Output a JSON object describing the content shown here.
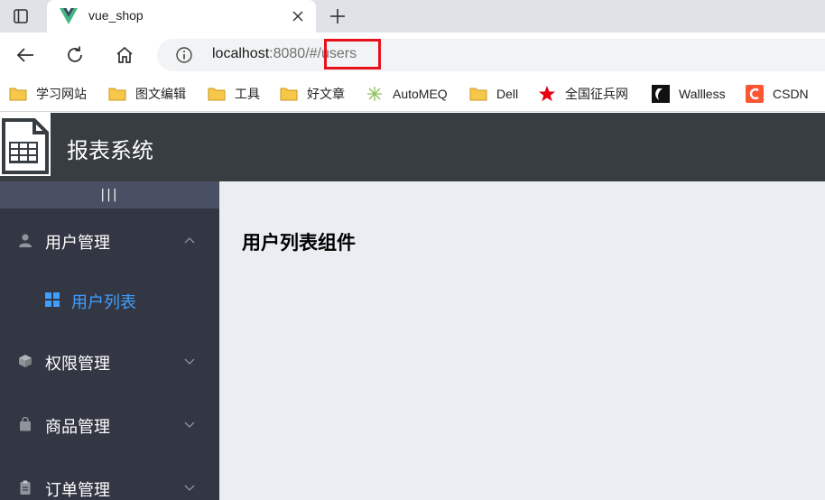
{
  "browser": {
    "tab_title": "vue_shop",
    "url_host": "localhost",
    "url_rest": ":8080/#/users"
  },
  "bookmarks": [
    {
      "label": "学习网站",
      "icon": "folder-icon"
    },
    {
      "label": "图文编辑",
      "icon": "folder-icon"
    },
    {
      "label": "工具",
      "icon": "folder-icon"
    },
    {
      "label": "好文章",
      "icon": "folder-icon"
    },
    {
      "label": "AutoMEQ",
      "icon": "automeq-icon"
    },
    {
      "label": "Dell",
      "icon": "folder-icon"
    },
    {
      "label": "全国征兵网",
      "icon": "star-icon"
    },
    {
      "label": "Wallless",
      "icon": "wallless-icon"
    },
    {
      "label": "CSDN",
      "icon": "csdn-icon"
    }
  ],
  "app": {
    "title": "报表系统",
    "toggle_label": "|||",
    "menu": [
      {
        "label": "用户管理",
        "icon": "user-icon",
        "expanded": true
      },
      {
        "label": "权限管理",
        "icon": "cube-icon",
        "expanded": false
      },
      {
        "label": "商品管理",
        "icon": "bag-icon",
        "expanded": false
      },
      {
        "label": "订单管理",
        "icon": "clipboard-icon",
        "expanded": false
      }
    ],
    "submenu_active": {
      "label": "用户列表",
      "icon": "grid-icon"
    },
    "main_title": "用户列表组件"
  },
  "colors": {
    "header_bg": "#373d41",
    "sidebar_bg": "#333744",
    "toggle_bg": "#4a5064",
    "main_bg": "#eaedf1",
    "active_text": "#409eff",
    "highlight_box": "#e8121c"
  }
}
